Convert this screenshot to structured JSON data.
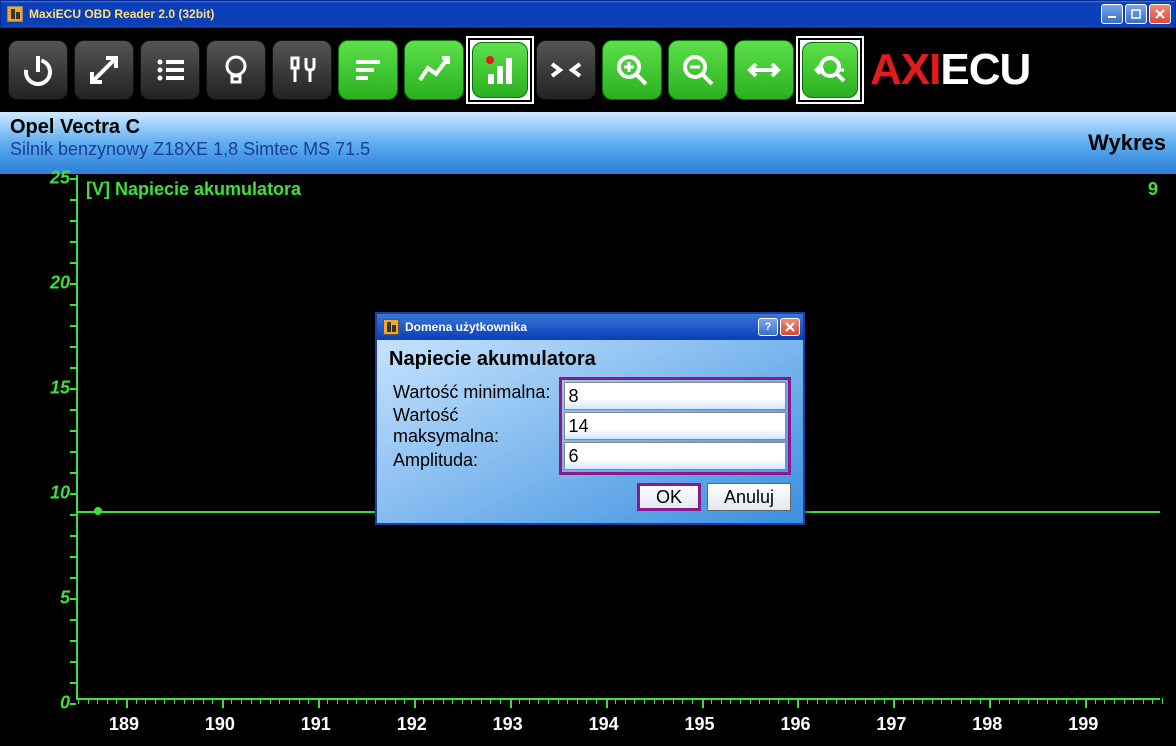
{
  "titlebar": {
    "text": "MaxiECU OBD Reader 2.0 (32bit)"
  },
  "toolbar": {
    "icons": [
      "power-icon",
      "expand-icon",
      "list-icon",
      "bulb-icon",
      "tools-icon",
      "filter-icon",
      "graph-icon",
      "bars-icon",
      "narrow-icon",
      "zoom-in-icon",
      "zoom-out-icon",
      "fit-width-icon",
      "zoom-fit-icon"
    ]
  },
  "logo": {
    "part1": "AXI",
    "part2": "ECU"
  },
  "vehicle": {
    "title": "Opel Vectra C",
    "subtitle": "Silnik benzynowy Z18XE 1,8 Simtec MS 71.5",
    "view": "Wykres"
  },
  "chart": {
    "title": "[V] Napiecie akumulatora",
    "reading": "9"
  },
  "chart_data": {
    "type": "line",
    "title": "[V] Napiecie akumulatora",
    "ylabel": "V",
    "xlabel": "",
    "ylim": [
      0,
      25
    ],
    "y_ticks": [
      0,
      5,
      10,
      15,
      20,
      25
    ],
    "xlim": [
      188.5,
      199.8
    ],
    "x_tick_labels": [
      189,
      190,
      191,
      192,
      193,
      194,
      195,
      196,
      197,
      198,
      199
    ],
    "series": [
      {
        "name": "Napiecie akumulatora",
        "value_constant": 9,
        "current": 9
      }
    ]
  },
  "dialog": {
    "title": "Domena użytkownika",
    "heading": "Napiecie akumulatora",
    "min_label": "Wartość minimalna:",
    "max_label": "Wartość maksymalna:",
    "amp_label": "Amplituda:",
    "min_value": "8",
    "max_value": "14",
    "amp_value": "6",
    "ok": "OK",
    "cancel": "Anuluj"
  }
}
